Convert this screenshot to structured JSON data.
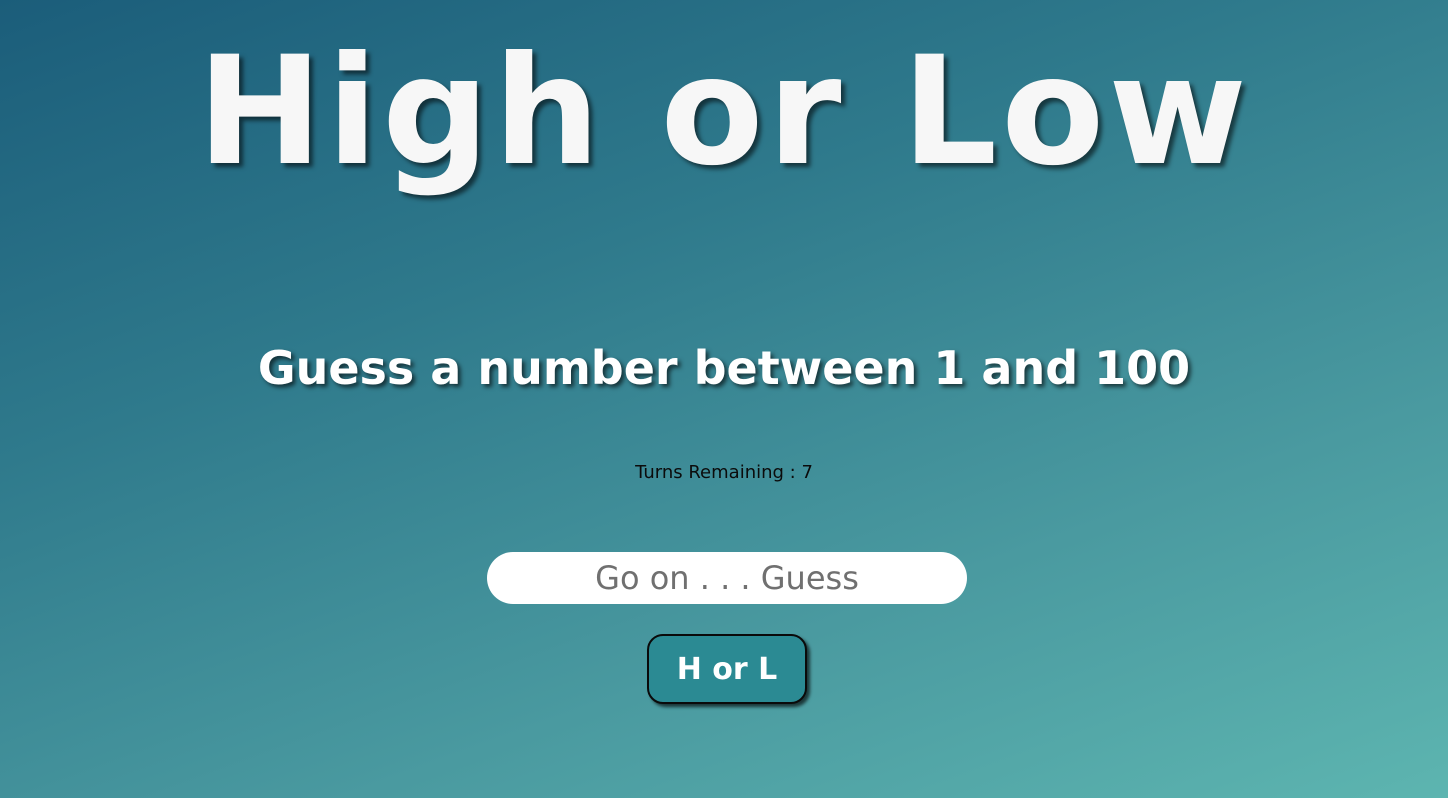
{
  "game": {
    "title": "High or Low",
    "instruction": "Guess a number between 1 and 100",
    "turns_remaining_text": "Turns Remaining : 7",
    "turns_remaining": 7,
    "guess_input": {
      "value": "",
      "placeholder": "Go on . . . Guess"
    },
    "submit_label": "H or L"
  },
  "colors": {
    "background_start": "#1b5d7a",
    "background_end": "#5db5b0",
    "button": "#2b8a93",
    "title_text": "#f7f7f7"
  }
}
